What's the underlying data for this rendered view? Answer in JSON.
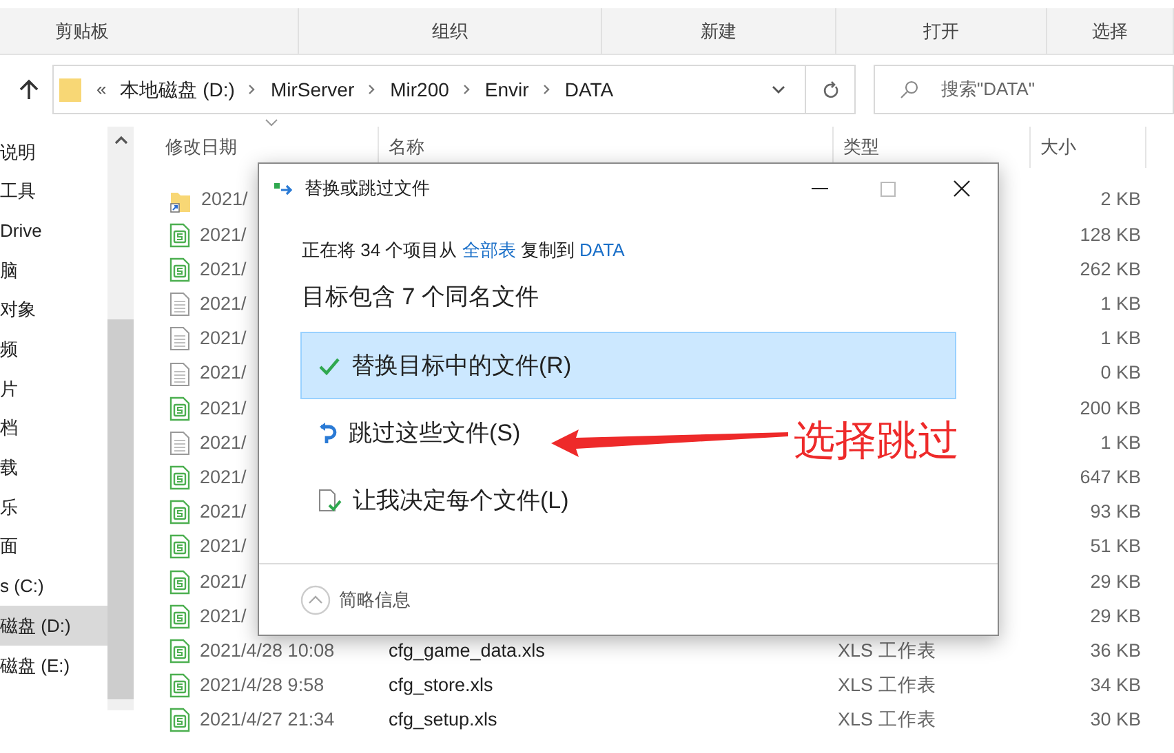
{
  "ribbon_groups": [
    "剪贴板",
    "组织",
    "新建",
    "打开",
    "选择"
  ],
  "address": {
    "overflow": "«",
    "crumbs": [
      "本地磁盘 (D:)",
      "MirServer",
      "Mir200",
      "Envir",
      "DATA"
    ],
    "search_placeholder": "搜索\"DATA\""
  },
  "sidebar": {
    "items": [
      {
        "label": "说明",
        "selected": false
      },
      {
        "label": "工具",
        "selected": false
      },
      {
        "label": "Drive",
        "selected": false
      },
      {
        "label": "脑",
        "selected": false
      },
      {
        "label": "对象",
        "selected": false
      },
      {
        "label": "频",
        "selected": false
      },
      {
        "label": "片",
        "selected": false
      },
      {
        "label": "档",
        "selected": false
      },
      {
        "label": "载",
        "selected": false
      },
      {
        "label": "乐",
        "selected": false
      },
      {
        "label": "面",
        "selected": false
      },
      {
        "label": "s (C:)",
        "selected": false
      },
      {
        "label": "磁盘 (D:)",
        "selected": true
      },
      {
        "label": "磁盘 (E:)",
        "selected": false
      }
    ]
  },
  "table": {
    "columns": [
      "修改日期",
      "名称",
      "类型",
      "大小"
    ],
    "rows": [
      {
        "kind": "shortcut",
        "date": "2021/",
        "size": "2 KB"
      },
      {
        "kind": "sheet",
        "date": "2021/",
        "size": "128 KB"
      },
      {
        "kind": "sheet",
        "date": "2021/",
        "size": "262 KB"
      },
      {
        "kind": "doc",
        "date": "2021/",
        "size": "1 KB"
      },
      {
        "kind": "doc",
        "date": "2021/",
        "size": "1 KB"
      },
      {
        "kind": "doc",
        "date": "2021/",
        "size": "0 KB"
      },
      {
        "kind": "sheet",
        "date": "2021/",
        "size": "200 KB"
      },
      {
        "kind": "doc",
        "date": "2021/",
        "size": "1 KB"
      },
      {
        "kind": "sheet",
        "date": "2021/",
        "size": "647 KB"
      },
      {
        "kind": "sheet",
        "date": "2021/",
        "size": "93 KB"
      },
      {
        "kind": "sheet",
        "date": "2021/",
        "size": "51 KB"
      },
      {
        "kind": "sheet",
        "date": "2021/",
        "size": "29 KB"
      },
      {
        "kind": "sheet",
        "date": "2021/",
        "size": "29 KB"
      },
      {
        "kind": "sheet",
        "date": "2021/4/28 10:08",
        "name": "cfg_game_data.xls",
        "type": "XLS 工作表",
        "size": "36 KB"
      },
      {
        "kind": "sheet",
        "date": "2021/4/28 9:58",
        "name": "cfg_store.xls",
        "type": "XLS 工作表",
        "size": "34 KB"
      },
      {
        "kind": "sheet",
        "date": "2021/4/27 21:34",
        "name": "cfg_setup.xls",
        "type": "XLS 工作表",
        "size": "30 KB"
      }
    ]
  },
  "dialog": {
    "title": "替换或跳过文件",
    "status": [
      "正在将 34 个项目从 ",
      "全部表",
      " 复制到 ",
      "DATA"
    ],
    "heading": "目标包含 7 个同名文件",
    "options": [
      {
        "kind": "replace",
        "label": "替换目标中的文件(R)",
        "selected": true
      },
      {
        "kind": "skip",
        "label": "跳过这些文件(S)",
        "selected": false
      },
      {
        "kind": "decide",
        "label": "让我决定每个文件(L)",
        "selected": false
      }
    ],
    "details": "简略信息"
  },
  "annotation": "选择跳过"
}
